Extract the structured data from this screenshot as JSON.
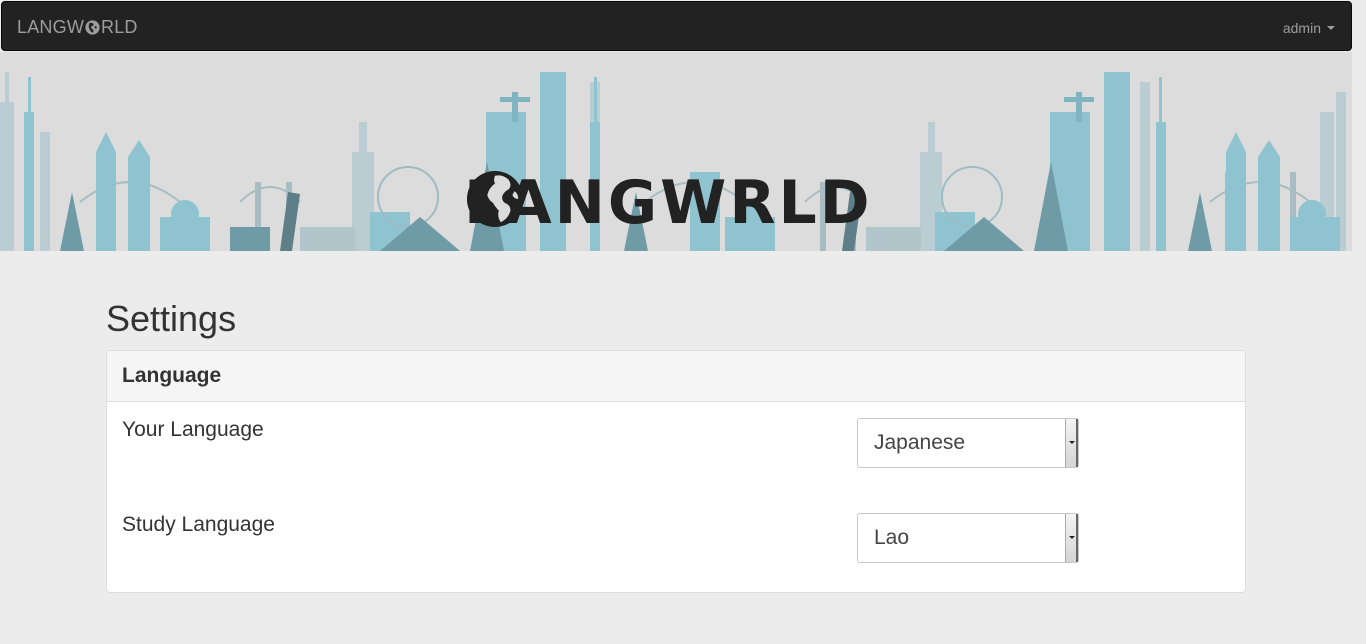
{
  "navbar": {
    "brand_prefix": "LANGW",
    "brand_suffix": "RLD",
    "user_label": "admin"
  },
  "banner": {
    "logo_prefix": "LANGW",
    "logo_suffix": "RLD",
    "colors": {
      "background": "#dcdcdc",
      "skyline_light": "#9fc9d4",
      "skyline_dark": "#7aa7b3",
      "skyline_grey": "#8f9ea3"
    }
  },
  "page": {
    "title": "Settings"
  },
  "panel": {
    "heading": "Language",
    "rows": [
      {
        "label": "Your Language",
        "selected": "Japanese"
      },
      {
        "label": "Study Language",
        "selected": "Lao"
      }
    ]
  },
  "icons": [
    "globe-icon",
    "caret-down-icon",
    "select-arrow-icon"
  ]
}
